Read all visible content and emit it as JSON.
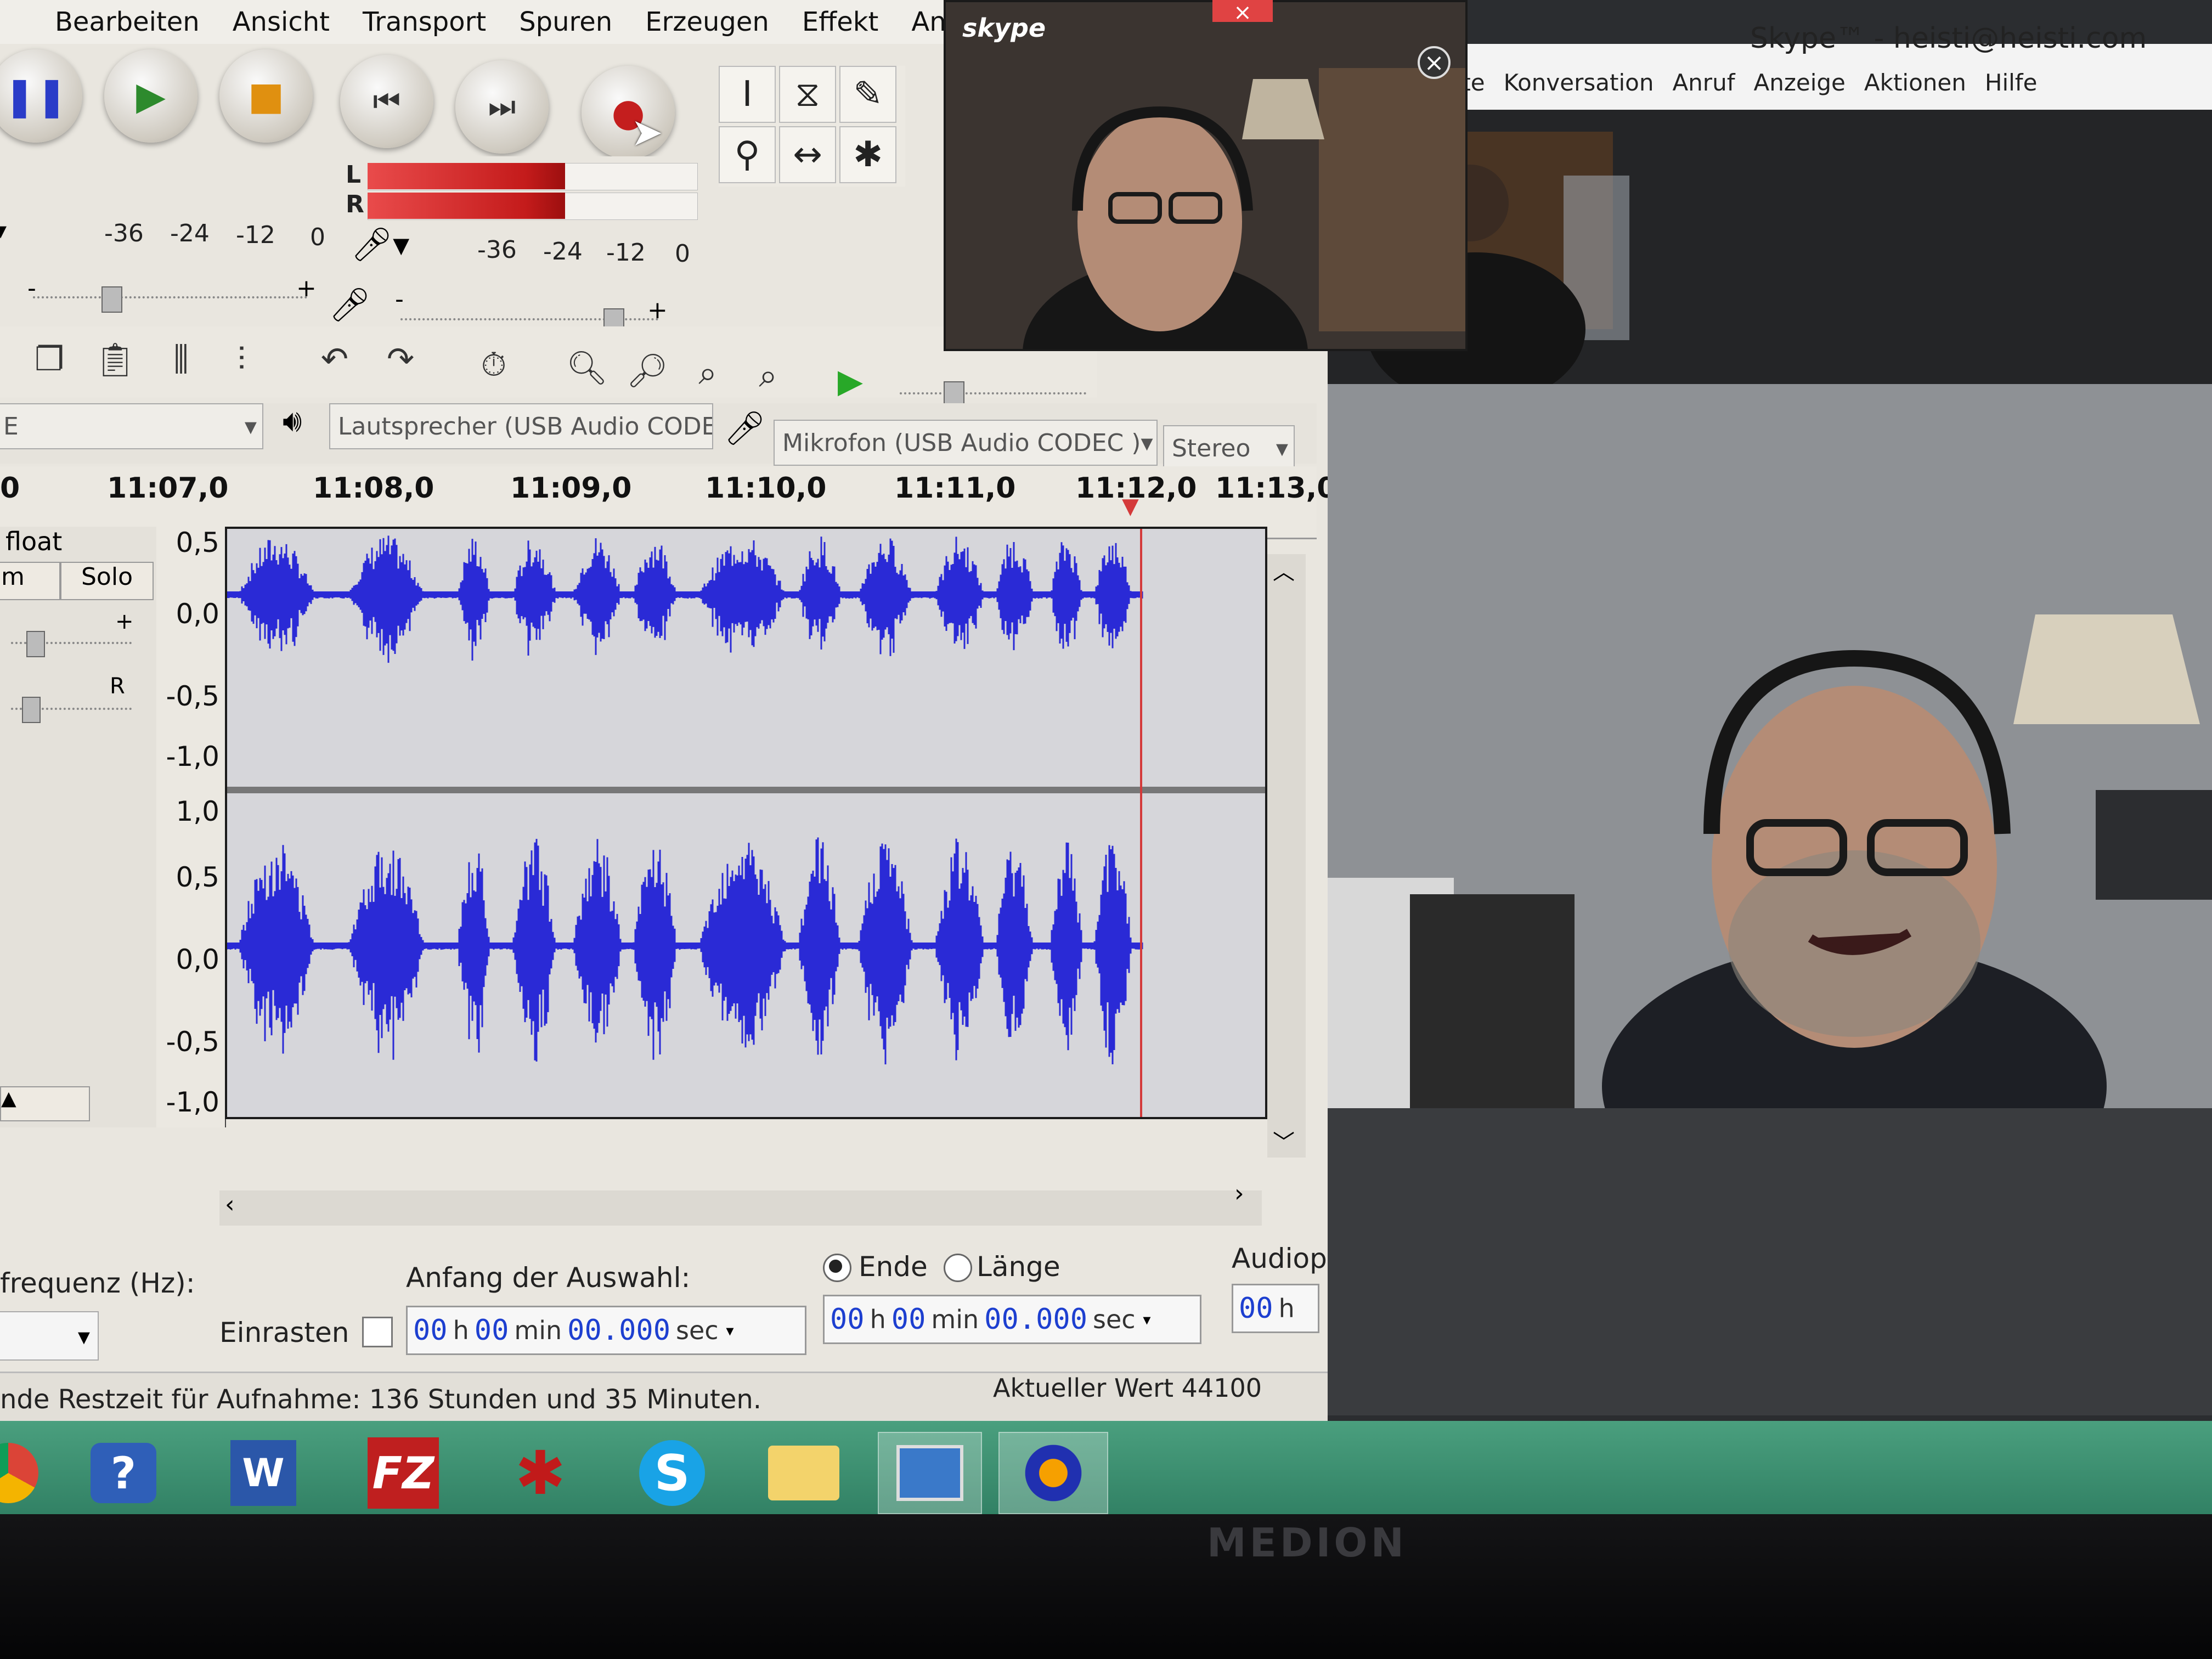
{
  "audacity": {
    "menu": [
      "Bearbeiten",
      "Ansicht",
      "Transport",
      "Spuren",
      "Erzeugen",
      "Effekt",
      "Analyse"
    ],
    "meter": {
      "channel_left": "L",
      "channel_right": "R",
      "playback_ticks": [
        "-36",
        "-24",
        "-12",
        "0"
      ],
      "record_ticks": [
        "-36",
        "-24",
        "-12",
        "0"
      ],
      "record_level_left": 0.6,
      "record_level_right": 0.6
    },
    "slider_minus": "-",
    "slider_plus": "+",
    "device": {
      "playback": "Lautsprecher (USB Audio CODE",
      "record": "Mikrofon (USB Audio CODEC )",
      "channels": "Stereo"
    },
    "ruler": {
      "start": "0",
      "ticks": [
        "11:07,0",
        "11:08,0",
        "11:09,0",
        "11:10,0",
        "11:11,0",
        "11:12,0",
        "11:13,0"
      ]
    },
    "track": {
      "format": "float",
      "mute_label": "m",
      "solo_label": "Solo",
      "gain_plus": "+",
      "pan_right": "R"
    },
    "y_axis_top": [
      "0,5",
      "0,0",
      "-0,5",
      "-1,0"
    ],
    "y_axis_bottom": [
      "1,0",
      "0,5",
      "0,0",
      "-0,5",
      "-1,0"
    ],
    "selection": {
      "frequency_label": "frequenz (Hz):",
      "snap_label": "Einrasten",
      "start_label": "Anfang der Auswahl:",
      "end_label": "Ende",
      "length_label": "Länge",
      "audio_label": "Audiop",
      "time": {
        "h": "00",
        "min": "00",
        "sec": "00.000"
      },
      "unit_h": "h",
      "unit_min": "min",
      "unit_sec": "sec",
      "audio_partial": "00"
    },
    "status": {
      "remaining": "nde Restzeit für Aufnahme: 136 Stunden und 35 Minuten.",
      "current": "Aktueller Wert 44100"
    }
  },
  "skype": {
    "small_logo": "skype",
    "title": "Skype™ - heisti@heisti.com",
    "menu": [
      "kte",
      "Konversation",
      "Anruf",
      "Anzeige",
      "Aktionen",
      "Hilfe"
    ]
  },
  "monitor": {
    "brand": "MEDION"
  },
  "colors": {
    "waveform": "#2a2ad6",
    "taskbar": "#3d8f70",
    "record_meter": "#d92c2c",
    "playhead": "#d43a3a"
  }
}
